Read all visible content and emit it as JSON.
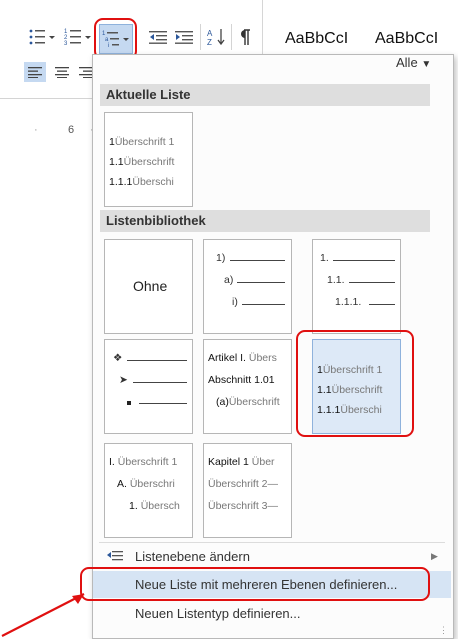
{
  "ribbon": {
    "styles_gallery": [
      "AaBbCcI",
      "AaBbCcI"
    ],
    "styles_more_label": "Alle",
    "ruler_label": "6"
  },
  "dropdown": {
    "current_list": {
      "header": "Aktuelle Liste",
      "lines": [
        {
          "num": "1",
          "text": "Überschrift 1"
        },
        {
          "num": "1.1",
          "text": "Überschrift"
        },
        {
          "num": "1.1.1",
          "text": "Überschi"
        }
      ]
    },
    "library": {
      "header": "Listenbibliothek",
      "none_label": "Ohne",
      "tile_paren": [
        "1)",
        "a)",
        "i)"
      ],
      "tile_decimal": [
        "1.",
        "1.1.",
        "1.1.1."
      ],
      "tile_articles": [
        {
          "num": "Artikel I.",
          "text": "Übers"
        },
        {
          "num": "Abschnitt 1.01",
          "text": ""
        },
        {
          "num": "(a)",
          "text": "Überschrift"
        }
      ],
      "tile_heading_numbered": [
        {
          "num": "1",
          "text": "Überschrift 1"
        },
        {
          "num": "1.1",
          "text": "Überschrift"
        },
        {
          "num": "1.1.1",
          "text": "Überschi"
        }
      ],
      "tile_roman": [
        {
          "num": "I.",
          "text": "Überschrift 1"
        },
        {
          "num": "A.",
          "text": "Überschri"
        },
        {
          "num": "1.",
          "text": "Übersch"
        }
      ],
      "tile_chapter": [
        {
          "num": "Kapitel 1",
          "text": "Über"
        },
        {
          "num": "",
          "text": "Überschrift 2—"
        },
        {
          "num": "",
          "text": "Überschrift 3—"
        }
      ]
    },
    "menu": {
      "change_level": "Listenebene ändern",
      "define_multilevel": "Neue Liste mit mehreren Ebenen definieren...",
      "define_style": "Neuen Listentyp definieren..."
    }
  },
  "colors": {
    "annotation_red": "#e01010",
    "highlight": "#d6e4f4",
    "selected_tile": "#dde9f7"
  }
}
